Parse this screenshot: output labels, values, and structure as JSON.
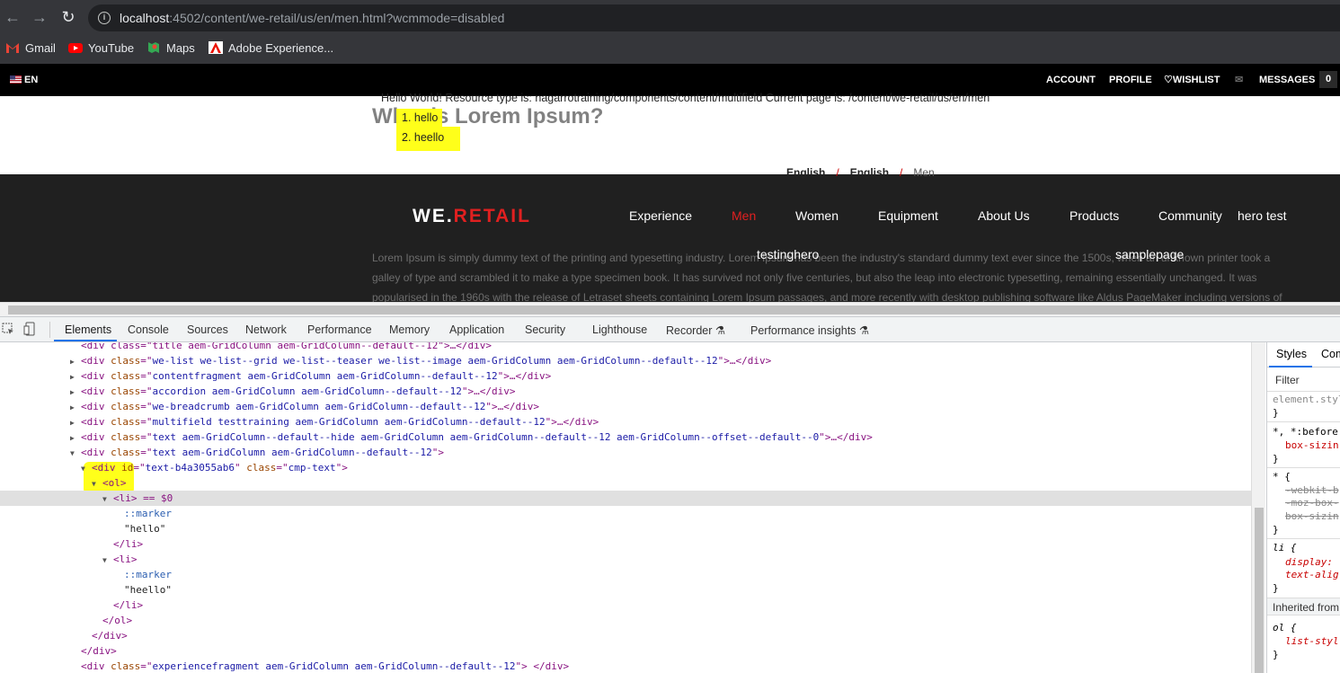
{
  "browser": {
    "url_host": "localhost",
    "url_rest": ":4502/content/we-retail/us/en/men.html?wcmmode=disabled",
    "bookmarks": [
      "Gmail",
      "YouTube",
      "Maps",
      "Adobe Experience..."
    ]
  },
  "page": {
    "lang": "EN",
    "top_nav": [
      "ACCOUNT",
      "PROFILE",
      "WISHLIST",
      "MESSAGES"
    ],
    "messages_count": "0",
    "hello_line": "Hello World! Resource type is: nagarrotraining/components/content/multifield Current page is: /content/we-retail/us/en/men",
    "list_items": [
      "1. hello",
      "2. heello"
    ],
    "breadcrumb": [
      "English",
      "English",
      "Men"
    ],
    "logo_we": "WE.",
    "logo_retail": "RETAIL",
    "nav_row1": [
      "Experience",
      "Men",
      "Women",
      "Equipment",
      "About Us",
      "Products",
      "Community",
      "hero test"
    ],
    "nav_row2": [
      "testinghero",
      "samplepage"
    ],
    "bg_title": "What is Lorem Ipsum?",
    "bg_para1": "Lorem Ipsum is simply dummy text of the printing and typesetting industry. Lorem Ipsum has been the industry's standard dummy text ever since the 1500s, when an unknown printer took a",
    "bg_para2": "galley of type and scrambled it to make a type specimen book. It has survived not only five centuries, but also the leap into electronic typesetting, remaining essentially unchanged. It was",
    "bg_para3": "popularised in the 1960s with the release of Letraset sheets containing Lorem Ipsum passages, and more recently with desktop publishing software like Aldus PageMaker including versions of"
  },
  "devtools": {
    "tabs": [
      "Elements",
      "Console",
      "Sources",
      "Network",
      "Performance",
      "Memory",
      "Application",
      "Security",
      "Lighthouse",
      "Recorder",
      "Performance insights"
    ],
    "dom": [
      {
        "indent": 80,
        "tri": "",
        "html": "<div class=\"title aem-GridColumn aem-GridColumn--default--12\">…</div>"
      },
      {
        "indent": 80,
        "tri": "▶",
        "tag": "div",
        "cls": "we-list we-list--grid we-list--teaser we-list--image aem-GridColumn aem-GridColumn--default--12",
        "end": ">…</div>"
      },
      {
        "indent": 80,
        "tri": "▶",
        "tag": "div",
        "cls": "contentfragment aem-GridColumn aem-GridColumn--default--12",
        "end": ">…</div>"
      },
      {
        "indent": 80,
        "tri": "▶",
        "tag": "div",
        "cls": "accordion aem-GridColumn aem-GridColumn--default--12",
        "end": ">…</div>"
      },
      {
        "indent": 80,
        "tri": "▶",
        "tag": "div",
        "cls": "we-breadcrumb aem-GridColumn aem-GridColumn--default--12",
        "end": ">…</div>"
      },
      {
        "indent": 80,
        "tri": "▶",
        "tag": "div",
        "cls": "multifield testtraining aem-GridColumn aem-GridColumn--default--12",
        "end": ">…</div>"
      },
      {
        "indent": 80,
        "tri": "▶",
        "tag": "div",
        "cls": "text aem-GridColumn--default--hide aem-GridColumn aem-GridColumn--default--12 aem-GridColumn--offset--default--0",
        "end": ">…</div>"
      },
      {
        "indent": 80,
        "tri": "▼",
        "tag": "div",
        "cls": "text aem-GridColumn aem-GridColumn--default--12",
        "end": ">"
      }
    ],
    "div_id": "text-b4a3055ab6",
    "div_class": "cmp-text",
    "ol": "<ol>",
    "li_sel": "<li> == $0",
    "marker": "::marker",
    "text1": "\"hello\"",
    "li_close": "</li>",
    "li_open": "<li>",
    "text2": "\"heello\"",
    "ol_close": "</ol>",
    "div_close": "</div>",
    "last_line_cls": "experiencefragment aem-GridColumn aem-GridColumn--default--12",
    "styles_tabs": [
      "Styles",
      "Com"
    ],
    "styles_filter": "Filter",
    "styles_lines": [
      "element.style",
      "}",
      "*, *:before,",
      "box-sizin",
      "}",
      "* {",
      "-webkit-b",
      "-moz-box-",
      "box-sizin",
      "}",
      "li {",
      "display:",
      "text-alig",
      "}",
      "Inherited from",
      "ol {",
      "list-styl",
      "}"
    ]
  }
}
